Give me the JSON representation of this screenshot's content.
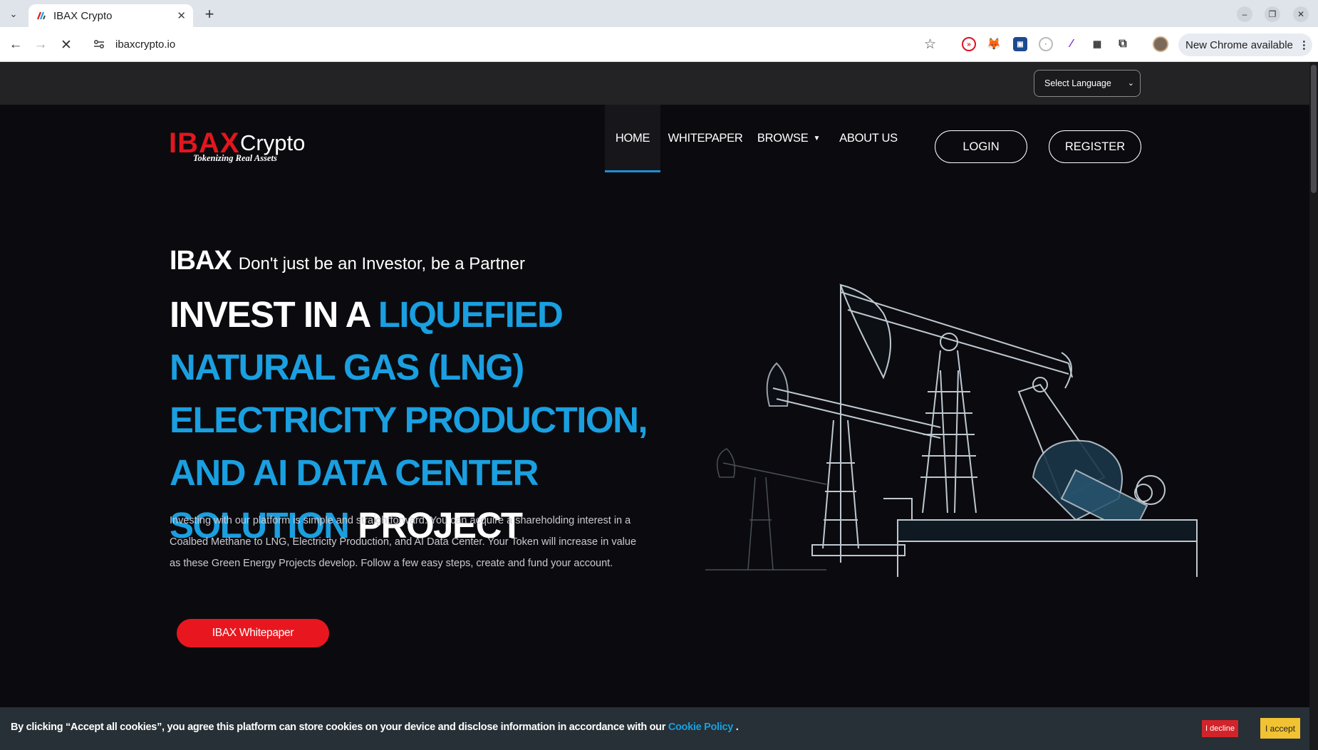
{
  "browser": {
    "tab_title": "IBAX Crypto",
    "url": "ibaxcrypto.io",
    "update_label": "New Chrome available",
    "extensions": [
      "extension-icon-1",
      "metamask-fox-icon",
      "extension-icon-3",
      "extension-icon-4",
      "feather-icon",
      "qr-icon",
      "puzzle-icon"
    ]
  },
  "topbar": {
    "language_select": "Select Language"
  },
  "header": {
    "logo": {
      "brand": "IBAX",
      "brand_suffix": "Crypto",
      "tagline": "Tokenizing Real Assets"
    },
    "nav": [
      {
        "label": "HOME",
        "active": true
      },
      {
        "label": "WHITEPAPER",
        "active": false
      },
      {
        "label": "BROWSE",
        "active": false,
        "dropdown": true
      },
      {
        "label": "ABOUT US",
        "active": false
      }
    ],
    "login_label": "LOGIN",
    "register_label": "REGISTER"
  },
  "hero": {
    "kicker_strong": "IBAX",
    "kicker_text": "Don't just be an Investor, be a Partner",
    "headline_white_1": "INVEST IN A ",
    "headline_blue": "LIQUEFIED NATURAL GAS (LNG) ELECTRICITY PRODUCTION, AND AI DATA CENTER SOLUTION",
    "headline_white_2": " PROJECT",
    "body": "Investing with our platform is simple and straightforward. You can acquire a shareholding interest in a Coalbed Methane to LNG, Electricity Production, and AI Data Center. Your Token will increase in value as these Green Energy Projects develop. Follow a few easy steps, create and fund your account.",
    "cta_label": "IBAX Whitepaper"
  },
  "cookie": {
    "text": "By clicking “Accept all cookies”, you agree this platform can store cookies on your device and disclose information in accordance with our ",
    "link": "Cookie Policy",
    "suffix": " .",
    "decline_label": "I decline",
    "accept_label": "I accept"
  },
  "colors": {
    "accent_blue": "#1a9fe0",
    "brand_red": "#e8171f",
    "background": "#0b0b0f",
    "cookie_bar": "#263036",
    "accept_yellow": "#f1c232"
  }
}
